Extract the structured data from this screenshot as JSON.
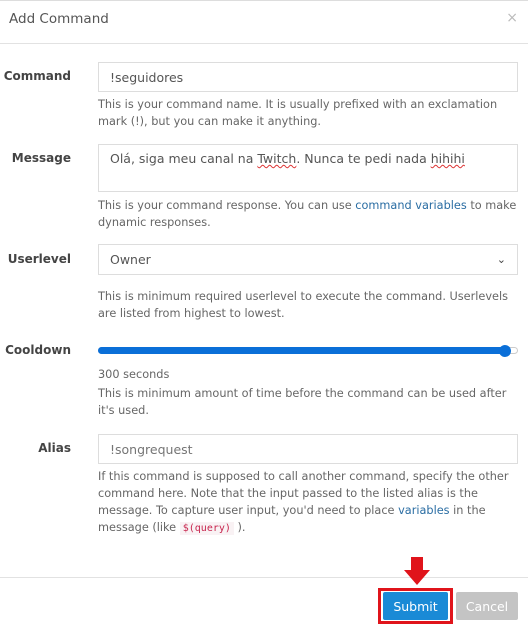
{
  "modal": {
    "title": "Add Command",
    "close_icon": "×"
  },
  "fields": {
    "command": {
      "label": "Command",
      "value": "!seguidores",
      "help": "This is your command name. It is usually prefixed with an exclamation mark (!), but you can make it anything."
    },
    "message": {
      "label": "Message",
      "value_parts": [
        "Olá, siga meu canal na ",
        "Twitch",
        ". Nunca te pedi nada ",
        "hihihi"
      ],
      "help_before": "This is your command response. You can use ",
      "help_link": "command variables",
      "help_after": " to make dynamic responses."
    },
    "userlevel": {
      "label": "Userlevel",
      "selected": "Owner",
      "help": "This is minimum required userlevel to execute the command. Userlevels are listed from highest to lowest."
    },
    "cooldown": {
      "label": "Cooldown",
      "value_text": "300 seconds",
      "fraction": 0.97,
      "help": "This is minimum amount of time before the command can be used after it's used."
    },
    "alias": {
      "label": "Alias",
      "placeholder": "!songrequest",
      "help_before": "If this command is supposed to call another command, specify the other command here. Note that the input passed to the listed alias is the message. To capture user input, you'd need to place ",
      "help_link": "variables",
      "help_mid": " in the message (like ",
      "help_code": "$(query)",
      "help_after": " )."
    }
  },
  "footer": {
    "submit": "Submit",
    "cancel": "Cancel"
  },
  "colors": {
    "accent": "#1a8ad6",
    "highlight": "#e0141b",
    "slider": "#0a6fd8"
  }
}
